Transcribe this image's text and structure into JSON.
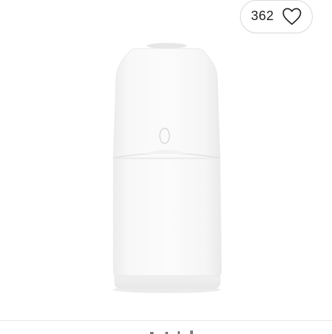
{
  "like_button": {
    "count": "362",
    "icon": "heart-outline-icon"
  },
  "product": {
    "image": "white-bin-product-image"
  },
  "colors": {
    "pill_border": "#d9d9d9",
    "text": "#222222",
    "product_body": "#f7f7f7"
  }
}
